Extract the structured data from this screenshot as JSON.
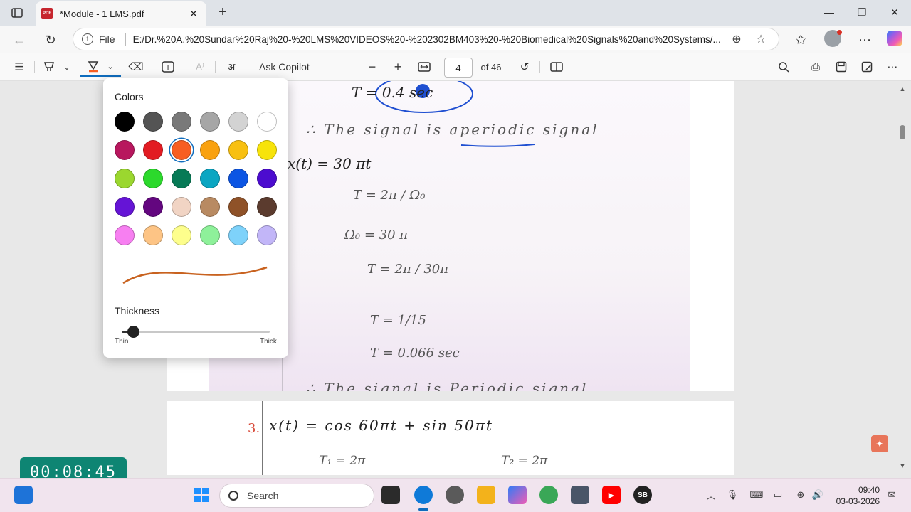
{
  "browser": {
    "tab_title": "*Module - 1 LMS.pdf",
    "tab_icon": "pdf-icon",
    "new_tab_icon": "plus-icon",
    "file_label": "File",
    "url": "E:/Dr.%20A.%20Sundar%20Raj%20-%20LMS%20VIDEOS%20-%202302BM403%20-%20Biomedical%20Signals%20and%20Systems/...",
    "window_controls": [
      "minimize",
      "restore",
      "close"
    ]
  },
  "pdf_toolbar": {
    "ask_copilot": "Ask Copilot",
    "zoom_out": "−",
    "zoom_in": "+",
    "page_current": "4",
    "page_total": "of 46"
  },
  "color_popup": {
    "title": "Colors",
    "thickness_title": "Thickness",
    "thin_label": "Thin",
    "thick_label": "Thick",
    "thickness_value": 0.04,
    "selected_color": "#f75e22",
    "preview_color": "#c8621f",
    "swatches": [
      "#000000",
      "#545454",
      "#797979",
      "#a6a6a6",
      "#d3d3d3",
      "#ffffff",
      "#b8175e",
      "#e21b22",
      "#f75e22",
      "#f9a10f",
      "#f8c010",
      "#f7e30a",
      "#9bd72f",
      "#2cd92c",
      "#077a56",
      "#0ba6c2",
      "#0c55e3",
      "#4c0ccf",
      "#6514d6",
      "#63067f",
      "#f1d4c4",
      "#b88a62",
      "#8f5228",
      "#5b3b2e",
      "#f77ff1",
      "#fdc485",
      "#fdfe8c",
      "#8ef19a",
      "#7ed2fa",
      "#c2b6f8"
    ]
  },
  "document": {
    "page1_lines": [
      "T = 0.4 sec",
      "∴ The signal is aperiodic signal",
      "x(t) = 30 πt",
      "T = 2π / Ω₀",
      "Ω₀ = 30 π",
      "T = 2π / 30π",
      "T = 1/15",
      "T = 0.066 sec",
      "∴ The signal is Periodic signal"
    ],
    "page2_number": "3.",
    "page2_line": "x(t) = cos 60πt + sin 50πt",
    "page2_t1": "T₁ = 2π",
    "page2_t2": "T₂ = 2π"
  },
  "timer": "00:08:45",
  "taskbar": {
    "search_placeholder": "Search",
    "time": "09:40",
    "date": "03-03-2026",
    "badge_label": "SB"
  }
}
